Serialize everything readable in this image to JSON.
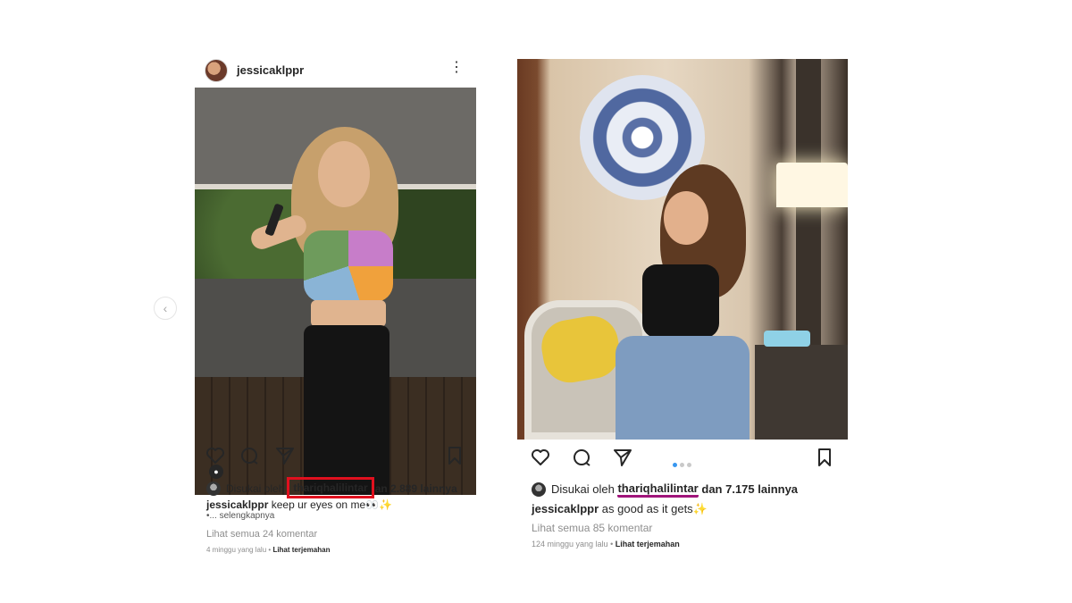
{
  "left_post": {
    "username": "jessicaklppr",
    "more_icon": "⋮",
    "liked_prefix": "Disukai oleh",
    "liked_user": "thariqhalilintar",
    "liked_suffix": "an 2.889 lainnya",
    "caption_user": "jessicaklppr",
    "caption_text": "keep ur eyes on me👀✨",
    "more": "•... selengkapnya",
    "comments": "Lihat semua 24 komentar",
    "time": "4 minggu yang lalu",
    "translate": "Lihat terjemahan",
    "tag_icon": "●"
  },
  "right_post": {
    "liked_prefix": "Disukai oleh",
    "liked_user": "thariqhalilintar",
    "liked_suffix": "dan 7.175 lainnya",
    "caption_user": "jessicaklppr",
    "caption_text": "as good as it gets✨",
    "comments": "Lihat semua 85 komentar",
    "time": "124 minggu yang lalu",
    "translate": "Lihat terjemahan"
  },
  "carousel": {
    "prev_icon": "‹"
  },
  "separator": "•",
  "colors": {
    "highlight_box": "#e0101e",
    "underline": "#a0147a",
    "active_dot": "#3897f0"
  }
}
